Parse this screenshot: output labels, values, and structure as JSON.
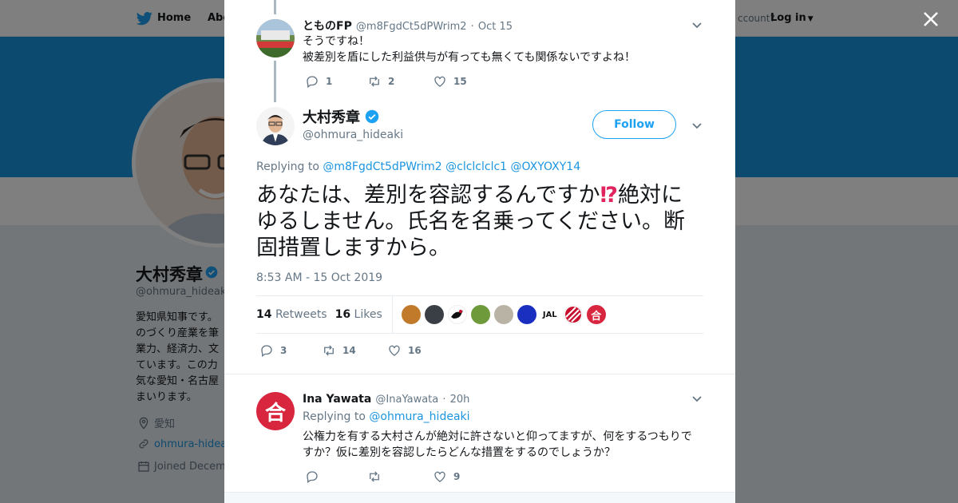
{
  "background": {
    "nav": {
      "home": "Home",
      "about": "Abo",
      "account_prompt": "ccount?",
      "login": "Log in"
    },
    "profile": {
      "name": "大村秀章",
      "handle": "@ohmura_hideak",
      "bio": "愛知県知事です。\nのづくり産業を筆\n業力、経済力、文\nています。この力\n気な愛知・名古屋\nまいります。",
      "location": "愛知",
      "link": "ohmura-hidea",
      "joined": "Joined Decem"
    }
  },
  "close_label": "×",
  "reply_tweet": {
    "name": "とものFP",
    "handle": "@m8FgdCt5dPWrim2",
    "time": "Oct 15",
    "text": "そうですね！\n被差別を盾にした利益供与が有っても無くても関係ないですよね！",
    "reply_count": "1",
    "retweet_count": "2",
    "like_count": "15"
  },
  "main_tweet": {
    "name": "大村秀章",
    "handle": "@ohmura_hideaki",
    "follow_label": "Follow",
    "replying_prefix": "Replying to",
    "replying_to": [
      "@m8FgdCt5dPWrim2",
      "@clclclclc1",
      "@OXYOXY14"
    ],
    "text_part1": "あなたは、差別を容認するんですか",
    "emoji": "⁉",
    "text_part2": "絶対にゆるしません。氏名を名乗ってください。断固措置しますから。",
    "timestamp": "8:53 AM - 15 Oct 2019",
    "retweets_count": "14",
    "retweets_label": "Retweets",
    "likes_count": "16",
    "likes_label": "Likes",
    "reply_count": "3",
    "retweet_count": "14",
    "like_count": "16",
    "faces": [
      "",
      "",
      "",
      "",
      "",
      "",
      "JAL",
      "",
      "合"
    ]
  },
  "second_reply": {
    "name": "Ina Yawata",
    "handle": "@InaYawata",
    "time": "20h",
    "replying_prefix": "Replying to",
    "replying_to": "@ohmura_hideaki",
    "text": "公権力を有する大村さんが絶対に許さないと仰ってますが、何をするつもりですか？仮に差別を容認したらどんな措置をするのでしょうか？",
    "reply_count": "",
    "retweet_count": "",
    "like_count": "9",
    "avatar_glyph": "合"
  },
  "colors": {
    "accent": "#1da1f2",
    "link": "#1b95e0",
    "verified": "#1da1f2",
    "emoji_red": "#e0245e"
  }
}
